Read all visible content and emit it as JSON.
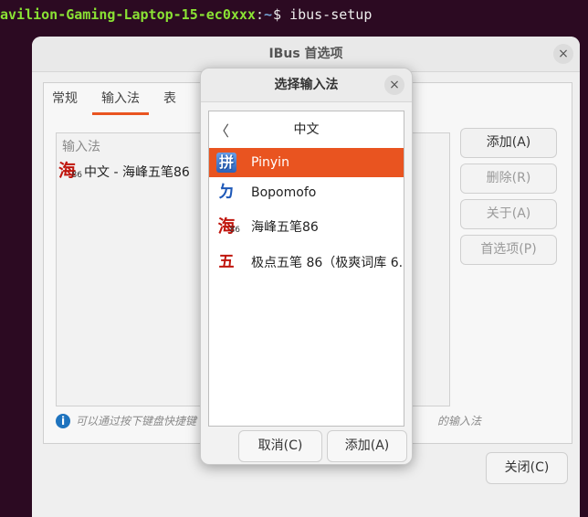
{
  "terminal": {
    "host": "avilion-Gaming-Laptop-15-ec0xxx",
    "sep": ":",
    "path": "~",
    "prompt": "$",
    "command": "ibus-setup"
  },
  "main_window": {
    "title": "IBus 首选项",
    "close_glyph": "×",
    "tabs": [
      {
        "label": "常规"
      },
      {
        "label": "输入法"
      },
      {
        "label": "表"
      }
    ],
    "list_header": "输入法",
    "list_items": [
      {
        "icon_char": "海",
        "icon_num": "86",
        "label": "中文 - 海峰五笔86"
      }
    ],
    "buttons": {
      "add": "添加(A)",
      "remove": "删除(R)",
      "about": "关于(A)",
      "preferences": "首选项(P)"
    },
    "info_text_left": "可以通过按下键盘快捷键",
    "info_text_right": "的输入法",
    "close_button": "关闭(C)"
  },
  "dialog": {
    "title": "选择输入法",
    "close_glyph": "×",
    "back_glyph": "〈",
    "language": "中文",
    "items": [
      {
        "icon_char": "拼",
        "label": "Pinyin",
        "selected": true
      },
      {
        "icon_char": "ㄉ",
        "label": "Bopomofo",
        "selected": false
      },
      {
        "icon_char": "海",
        "icon_num": "86",
        "label": "海峰五笔86",
        "selected": false
      },
      {
        "icon_char": "五",
        "label": "极点五笔 86（极爽词库 6.",
        "selected": false
      }
    ],
    "cancel_button": "取消(C)",
    "add_button": "添加(A)"
  },
  "colors": {
    "accent": "#e95420",
    "terminal_bg": "#2c0a22"
  }
}
